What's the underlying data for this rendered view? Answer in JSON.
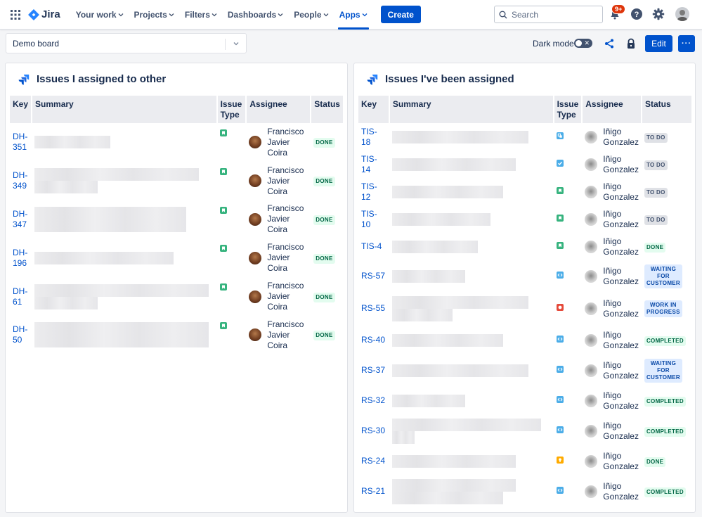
{
  "nav": {
    "app_name": "Jira",
    "items": [
      {
        "label": "Your work"
      },
      {
        "label": "Projects"
      },
      {
        "label": "Filters"
      },
      {
        "label": "Dashboards"
      },
      {
        "label": "People"
      },
      {
        "label": "Apps"
      }
    ],
    "active_item": "Apps",
    "create_label": "Create",
    "search_placeholder": "Search",
    "notification_badge": "9+",
    "icons": [
      "app-switcher-icon",
      "jira-logo-icon",
      "search-icon",
      "notification-icon",
      "help-icon",
      "settings-icon",
      "profile-avatar"
    ]
  },
  "board_bar": {
    "board_name": "Demo board",
    "dark_mode_label": "Dark mode",
    "dark_mode_on": false,
    "edit_label": "Edit",
    "more_label": "···"
  },
  "colors": {
    "brand_blue": "#0052cc",
    "done_green": "#006644",
    "story_green": "#36b37e",
    "task_blue": "#4bade8",
    "bug_red": "#e5493a",
    "improvement_orange": "#ffab00"
  },
  "panel_left": {
    "title": "Issues I assigned to other",
    "columns": [
      "Key",
      "Summary",
      "Issue Type",
      "Assignee",
      "Status"
    ],
    "rows": [
      {
        "key_a": "DH-",
        "key_b": "351",
        "summary_lines": [
          108
        ],
        "type": "story-icon",
        "assignee": [
          "Francisco",
          "Javier",
          "Coira"
        ],
        "status": "DONE"
      },
      {
        "key_a": "DH-",
        "key_b": "349",
        "summary_lines": [
          234,
          90
        ],
        "type": "story-icon",
        "assignee": [
          "Francisco",
          "Javier",
          "Coira"
        ],
        "status": "DONE"
      },
      {
        "key_a": "DH-",
        "key_b": "347",
        "summary_lines": [
          216,
          216
        ],
        "type": "story-icon",
        "assignee": [
          "Francisco",
          "Javier",
          "Coira"
        ],
        "status": "DONE"
      },
      {
        "key_a": "DH-",
        "key_b": "196",
        "summary_lines": [
          198
        ],
        "type": "story-icon",
        "assignee": [
          "Francisco",
          "Javier",
          "Coira"
        ],
        "status": "DONE"
      },
      {
        "key_a": "DH-",
        "key_b": "61",
        "summary_lines": [
          248,
          90
        ],
        "type": "story-icon",
        "assignee": [
          "Francisco",
          "Javier",
          "Coira"
        ],
        "status": "DONE"
      },
      {
        "key_a": "DH-",
        "key_b": "50",
        "summary_lines": [
          248,
          248
        ],
        "type": "story-icon",
        "assignee": [
          "Francisco",
          "Javier",
          "Coira"
        ],
        "status": "DONE"
      }
    ]
  },
  "panel_right": {
    "title": "Issues I've been assigned",
    "columns": [
      "Key",
      "Summary",
      "Issue Type",
      "Assignee",
      "Status"
    ],
    "rows": [
      {
        "key": "TIS-18",
        "summary_lines": [
          194
        ],
        "type": "subtask-icon",
        "assignee": [
          "Iñigo",
          "Gonzalez"
        ],
        "status": [
          "TO DO"
        ],
        "status_kind": "todo"
      },
      {
        "key": "TIS-14",
        "summary_lines": [
          176
        ],
        "type": "task-icon",
        "assignee": [
          "Iñigo",
          "Gonzalez"
        ],
        "status": [
          "TO DO"
        ],
        "status_kind": "todo"
      },
      {
        "key": "TIS-12",
        "summary_lines": [
          158
        ],
        "type": "story-icon",
        "assignee": [
          "Iñigo",
          "Gonzalez"
        ],
        "status": [
          "TO DO"
        ],
        "status_kind": "todo"
      },
      {
        "key": "TIS-10",
        "summary_lines": [
          140
        ],
        "type": "story-icon",
        "assignee": [
          "Iñigo",
          "Gonzalez"
        ],
        "status": [
          "TO DO"
        ],
        "status_kind": "todo"
      },
      {
        "key": "TIS-4",
        "summary_lines": [
          122
        ],
        "type": "story-icon",
        "assignee": [
          "Iñigo",
          "Gonzalez"
        ],
        "status": [
          "DONE"
        ],
        "status_kind": "done"
      },
      {
        "key": "RS-57",
        "summary_lines": [
          104
        ],
        "type": "service-request-icon",
        "assignee": [
          "Iñigo",
          "Gonzalez"
        ],
        "status": [
          "WAITING",
          "FOR",
          "CUSTOMER"
        ],
        "status_kind": "blue"
      },
      {
        "key": "RS-55",
        "summary_lines": [
          194,
          86
        ],
        "type": "bug-icon",
        "assignee": [
          "Iñigo",
          "Gonzalez"
        ],
        "status": [
          "WORK IN",
          "PROGRESS"
        ],
        "status_kind": "blue"
      },
      {
        "key": "RS-40",
        "summary_lines": [
          158
        ],
        "type": "service-request-icon",
        "assignee": [
          "Iñigo",
          "Gonzalez"
        ],
        "status": [
          "COMPLETED"
        ],
        "status_kind": "done"
      },
      {
        "key": "RS-37",
        "summary_lines": [
          194
        ],
        "type": "service-request-icon",
        "assignee": [
          "Iñigo",
          "Gonzalez"
        ],
        "status": [
          "WAITING",
          "FOR",
          "CUSTOMER"
        ],
        "status_kind": "blue"
      },
      {
        "key": "RS-32",
        "summary_lines": [
          104
        ],
        "type": "service-request-icon",
        "assignee": [
          "Iñigo",
          "Gonzalez"
        ],
        "status": [
          "COMPLETED"
        ],
        "status_kind": "done"
      },
      {
        "key": "RS-30",
        "summary_lines": [
          212,
          32
        ],
        "type": "service-request-icon",
        "assignee": [
          "Iñigo",
          "Gonzalez"
        ],
        "status": [
          "COMPLETED"
        ],
        "status_kind": "done"
      },
      {
        "key": "RS-24",
        "summary_lines": [
          176
        ],
        "type": "improvement-icon",
        "assignee": [
          "Iñigo",
          "Gonzalez"
        ],
        "status": [
          "DONE"
        ],
        "status_kind": "done"
      },
      {
        "key": "RS-21",
        "summary_lines": [
          176,
          158
        ],
        "type": "service-request-icon",
        "assignee": [
          "Iñigo",
          "Gonzalez"
        ],
        "status": [
          "COMPLETED"
        ],
        "status_kind": "done"
      }
    ]
  }
}
